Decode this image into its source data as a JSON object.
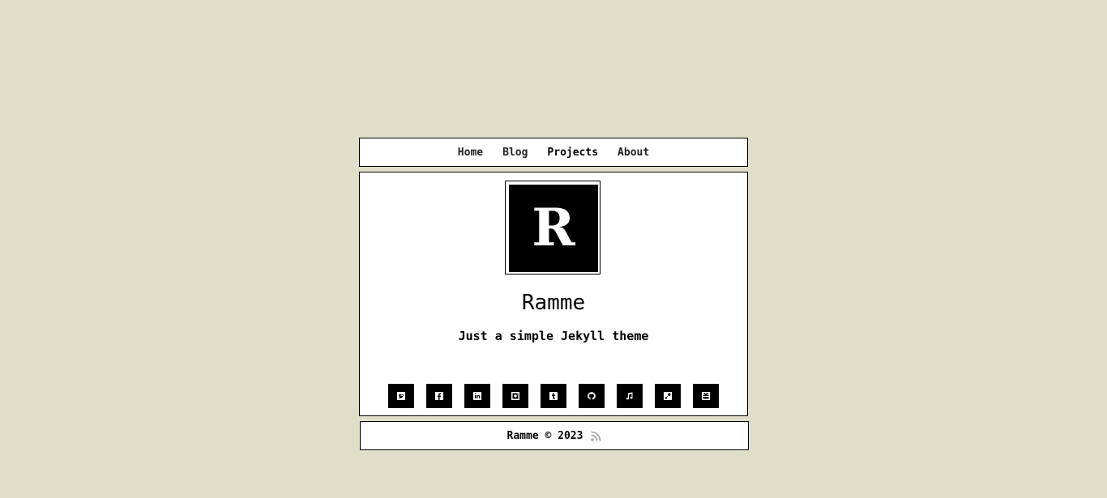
{
  "nav": {
    "items": [
      {
        "label": "Home"
      },
      {
        "label": "Blog"
      },
      {
        "label": "Projects"
      },
      {
        "label": "About"
      }
    ]
  },
  "profile": {
    "logo_letter": "R",
    "title": "Ramme",
    "subtitle": "Just a simple Jekyll theme"
  },
  "socials": [
    {
      "icon": "twitter-icon"
    },
    {
      "icon": "facebook-icon"
    },
    {
      "icon": "linkedin-icon"
    },
    {
      "icon": "instagram-icon"
    },
    {
      "icon": "tumblr-icon"
    },
    {
      "icon": "github-icon"
    },
    {
      "icon": "music-icon"
    },
    {
      "icon": "steam-icon"
    },
    {
      "icon": "youtube-icon"
    }
  ],
  "footer": {
    "text": "Ramme © 2023",
    "rss_icon": "rss-icon"
  },
  "colors": {
    "background": "#dfdfc9",
    "card": "#ffffff",
    "accent": "#000000"
  }
}
